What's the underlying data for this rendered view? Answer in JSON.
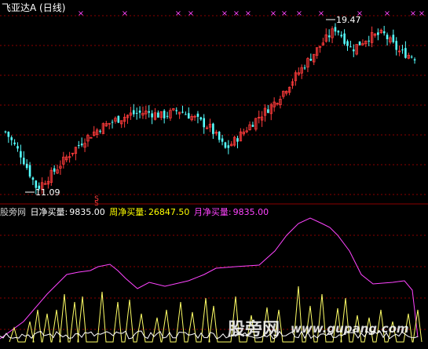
{
  "title": "飞亚达A (日线)",
  "upper": {
    "high_label": "19.47",
    "low_label": "11.09",
    "marker_glyph": "×",
    "signal_glyph": "S",
    "colors": {
      "up": "#ff3b3b",
      "down": "#55ffff",
      "grid": "#8b0000",
      "marker": "#ff44ff",
      "label": "#ffffff"
    }
  },
  "lower": {
    "watermark_left": "股旁网",
    "items": [
      {
        "label": "日净买量:",
        "value": "9835.00",
        "color": "#ffffff"
      },
      {
        "label": "周净买量:",
        "value": "26847.50",
        "color": "#ffff00"
      },
      {
        "label": "月净买量:",
        "value": "9835.00",
        "color": "#ff44ff"
      }
    ]
  },
  "watermark": {
    "cn": "股旁网",
    "url": "www.gupang.com"
  },
  "chart_data": [
    {
      "type": "candlestick",
      "title": "飞亚达A (日线)",
      "annotations": [
        {
          "text": "19.47",
          "kind": "high"
        },
        {
          "text": "11.09",
          "kind": "low"
        }
      ],
      "approx_close_path": [
        14.0,
        12.8,
        11.1,
        11.9,
        12.8,
        13.6,
        14.2,
        14.6,
        14.9,
        15.0,
        14.8,
        15.1,
        14.7,
        14.2,
        13.1,
        13.9,
        14.7,
        15.4,
        16.4,
        17.4,
        18.4,
        19.3,
        18.2,
        18.8,
        19.0,
        18.1,
        17.8
      ]
    },
    {
      "type": "line",
      "series": [
        {
          "name": "日净买量",
          "color": "#ffffff",
          "last": 9835.0,
          "shape": "spikes"
        },
        {
          "name": "周净买量",
          "color": "#ffff00",
          "last": 26847.5,
          "shape": "sawtooth"
        },
        {
          "name": "月净买量",
          "color": "#ff44ff",
          "last": 9835.0,
          "shape": "smooth"
        }
      ]
    }
  ]
}
